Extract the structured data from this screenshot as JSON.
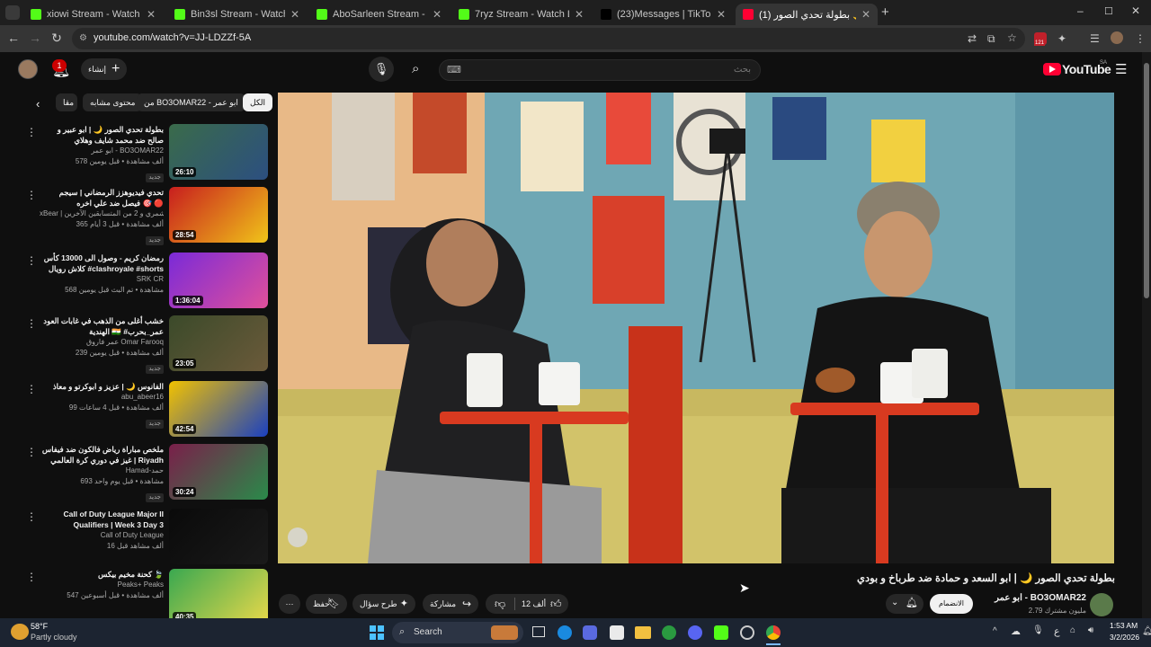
{
  "browser": {
    "tabs": [
      {
        "title": "xiowi Stream - Watch Live on Ki",
        "favicon": "#53fc18",
        "active": false
      },
      {
        "title": "Bin3sl Stream - Watch Live on K",
        "favicon": "#53fc18",
        "active": false
      },
      {
        "title": "AboSarleen Stream - Watch Liv",
        "favicon": "#53fc18",
        "active": false
      },
      {
        "title": "7ryz Stream - Watch Live on Ki",
        "favicon": "#53fc18",
        "active": false
      },
      {
        "title": "(23)Messages | TikTok",
        "favicon": "#000000",
        "active": false
      },
      {
        "title": "(1) بطولة تحدي الصور 🌙",
        "favicon": "#ff0033",
        "active": true
      }
    ],
    "url": "youtube.com/watch?v=JJ-LDZZf-5A",
    "ext_badge": "121"
  },
  "youtube": {
    "logo": "YouTube",
    "logo_region": "SA",
    "search_placeholder": "بحث",
    "search_kbd": "⌨",
    "create_label": "إنشاء",
    "notif_count": "1"
  },
  "chips": [
    {
      "label": "الكل",
      "selected": true
    },
    {
      "label": "من BO3OMAR22 - ابو عمر",
      "selected": false
    },
    {
      "label": "محتوى مشابه",
      "selected": false
    },
    {
      "label": "مقا",
      "selected": false
    }
  ],
  "recommendations": [
    {
      "title": "بطولة تحدي الصور 🌙 | ابو عبير و صالح ضد محمد شايف وهلاي",
      "channel": "ابو عمر - BO3OMAR22",
      "stats": "578 ألف مشاهدة • قبل يومين",
      "badge": "جديد",
      "duration": "26:10",
      "thumb": [
        "#3a6b4a",
        "#2c4f80"
      ]
    },
    {
      "title": "تحدي فيديوهزز الرمضاني | سيجم فيصل ضد علي اخره 🎯 🔴",
      "channel": "xBear | ابو عابد الشمري و 2 من المتسابقين الآخرين",
      "stats": "365 ألف مشاهدة • قبل 3 أيام",
      "badge": "جديد",
      "duration": "28:54",
      "thumb": [
        "#c81e1e",
        "#f0c419"
      ]
    },
    {
      "title": "رمضان كريم - وصول الى 13000 كأس كلاش رويال #clashroyale #shorts",
      "channel": "SRK CR",
      "stats": "568 مشاهدة • تم البث قبل يومين",
      "badge": "",
      "duration": "1:36:04",
      "thumb": [
        "#7a2ad8",
        "#e0509b"
      ]
    },
    {
      "title": "خشب أغلى من الذهب في غابات العود الهندية 🇮🇳 #عمر_بحرب",
      "channel": "عمر فاروق Omar Farooq",
      "stats": "239 ألف مشاهدة • قبل يومين",
      "badge": "جديد",
      "duration": "23:05",
      "thumb": [
        "#3b4a2a",
        "#6b5a3a"
      ]
    },
    {
      "title": "الفانوس 🌙 | عزيز و ابوكرتو و معاذ",
      "channel": "abu_abeer16",
      "stats": "99 ألف مشاهدة • قبل 4 ساعات",
      "badge": "جديد",
      "duration": "42:54",
      "thumb": [
        "#f2c200",
        "#1a40c0"
      ]
    },
    {
      "title": "ملخص مباراة رياض فالكون ضد فيفاس غيز في دوري كرة العالمي | Riyadh Falcons...",
      "channel": "Hamad-حمد",
      "stats": "693 مشاهدة • قبل يوم واحد",
      "badge": "جديد",
      "duration": "30:24",
      "thumb": [
        "#7a1f4a",
        "#2a8a4a"
      ]
    },
    {
      "title": "Call of Duty League Major II Qualifiers | Week 3 Day 3",
      "channel": "Call of Duty League",
      "stats": "16 ألف مشاهد قبل",
      "badge": "",
      "duration": "",
      "thumb": [
        "#0a0a0a",
        "#1a1a1a"
      ]
    },
    {
      "title": "كحنة مخيم بيكس 🍃",
      "channel": "Peaks+ Peaks",
      "stats": "547 ألف مشاهدة • قبل أسبوعين",
      "badge": "",
      "duration": "40:35",
      "thumb": [
        "#3aa850",
        "#e8d84a"
      ]
    }
  ],
  "video": {
    "title": "بطولة تحدي الصور 🌙 | ابو السعد و حمادة ضد طرباخ و بودي",
    "channel": "ابو عمر - BO3OMAR22",
    "subscribers": "2.79 مليون مشترك",
    "join_label": "الانضمام",
    "likes": "12 ألف",
    "share_label": "مشاركة",
    "ask_label": "طرح سؤال",
    "save_label": "حفظ"
  },
  "taskbar": {
    "weather_temp": "58°F",
    "weather_desc": "Partly cloudy",
    "search_label": "Search",
    "time": "1:53 AM",
    "date": "3/2/2026",
    "lang": "ع"
  }
}
